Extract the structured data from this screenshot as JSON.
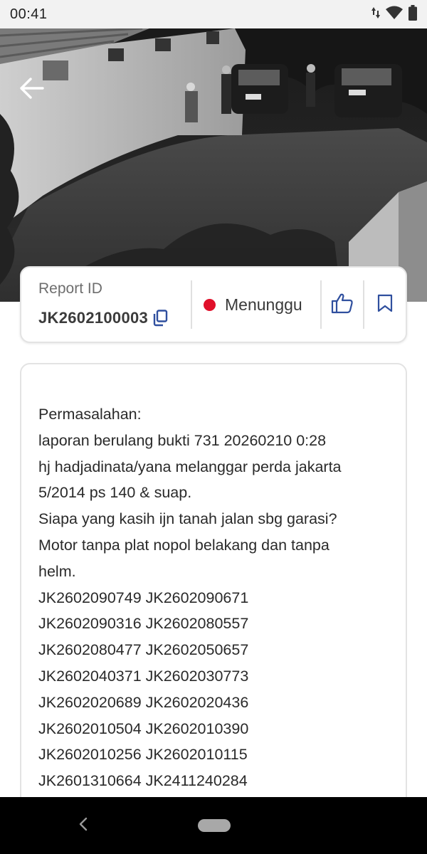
{
  "status_bar": {
    "time": "00:41",
    "icons": [
      "data-arrows-icon",
      "wifi-icon",
      "battery-icon"
    ]
  },
  "header": {
    "back_icon": "arrow-left-icon"
  },
  "report": {
    "id_label": "Report ID",
    "id_value": "JK2602100003",
    "status": "Menunggu",
    "status_color": "#e0102a",
    "accent_color": "#2f4f9e"
  },
  "description": {
    "text": "Permasalahan:\nlaporan berulang bukti 731 20260210 0:28\nhj hadjadinata/yana melanggar perda jakarta\n5/2014 ps 140 & suap.\nSiapa yang kasih ijn tanah jalan sbg garasi?\nMotor tanpa plat nopol belakang dan tanpa\nhelm.\nJK2602090749 JK2602090671\nJK2602090316 JK2602080557\nJK2602080477 JK2602050657\nJK2602040371 JK2602030773\nJK2602020689 JK2602020436\nJK2602010504 JK2602010390\nJK2602010256 JK2602010115\nJK2601310664 JK2411240284"
  }
}
